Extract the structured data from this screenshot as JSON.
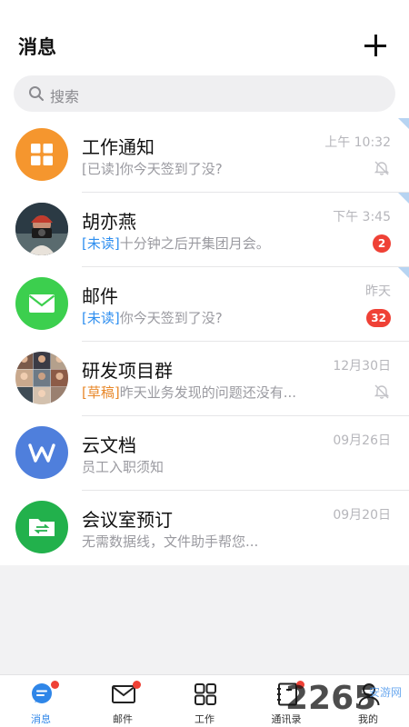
{
  "header": {
    "title": "消息",
    "add_icon": "plus-icon"
  },
  "search": {
    "placeholder": "搜索",
    "icon": "search-icon"
  },
  "conversations": [
    {
      "name": "工作通知",
      "time": "上午 10:32",
      "tag": "[已读]",
      "tag_type": "read",
      "text": "你今天签到了没?",
      "muted": true,
      "badge": "",
      "pinned": true,
      "avatar": "grid-app-icon",
      "color": "#f5962e"
    },
    {
      "name": "胡亦燕",
      "time": "下午 3:45",
      "tag": "[未读]",
      "tag_type": "unread",
      "text": "十分钟之后开集团月会。",
      "muted": false,
      "badge": "2",
      "pinned": true,
      "avatar": "photo-avatar"
    },
    {
      "name": "邮件",
      "time": "昨天",
      "tag": "[未读]",
      "tag_type": "unread",
      "text": "你今天签到了没?",
      "muted": false,
      "badge": "32",
      "pinned": true,
      "avatar": "mail-app-icon",
      "color": "#3ccf4e"
    },
    {
      "name": "研发项目群",
      "time": "12月30日",
      "tag": "[草稿]",
      "tag_type": "draft",
      "text": "昨天业务发现的问题还没有...",
      "muted": true,
      "badge": "",
      "pinned": false,
      "avatar": "group-avatar"
    },
    {
      "name": "云文档",
      "time": "09月26日",
      "tag": "",
      "tag_type": "",
      "text": "员工入职须知",
      "muted": false,
      "badge": "",
      "pinned": false,
      "avatar": "wps-app-icon",
      "color": "#4f7fdc"
    },
    {
      "name": "会议室预订",
      "time": "09月20日",
      "tag": "",
      "tag_type": "",
      "text": "无需数据线，文件助手帮您...",
      "muted": false,
      "badge": "",
      "pinned": false,
      "avatar": "file-transfer-icon",
      "color": "#22b14c"
    }
  ],
  "tabbar": [
    {
      "label": "消息",
      "icon": "chat-icon",
      "active": true,
      "dot": true
    },
    {
      "label": "邮件",
      "icon": "mail-icon",
      "active": false,
      "dot": true
    },
    {
      "label": "工作",
      "icon": "apps-grid-icon",
      "active": false,
      "dot": false
    },
    {
      "label": "通讯录",
      "icon": "contacts-icon",
      "active": false,
      "dot": true
    },
    {
      "label": "我的",
      "icon": "profile-icon",
      "active": false,
      "dot": false
    }
  ],
  "watermark": {
    "text": "2265",
    "suffix": "安游网"
  },
  "colors": {
    "accent": "#2f86e8",
    "badge": "#ef4136",
    "unread_tag": "#2f8ff0",
    "draft_tag": "#e8882a"
  }
}
